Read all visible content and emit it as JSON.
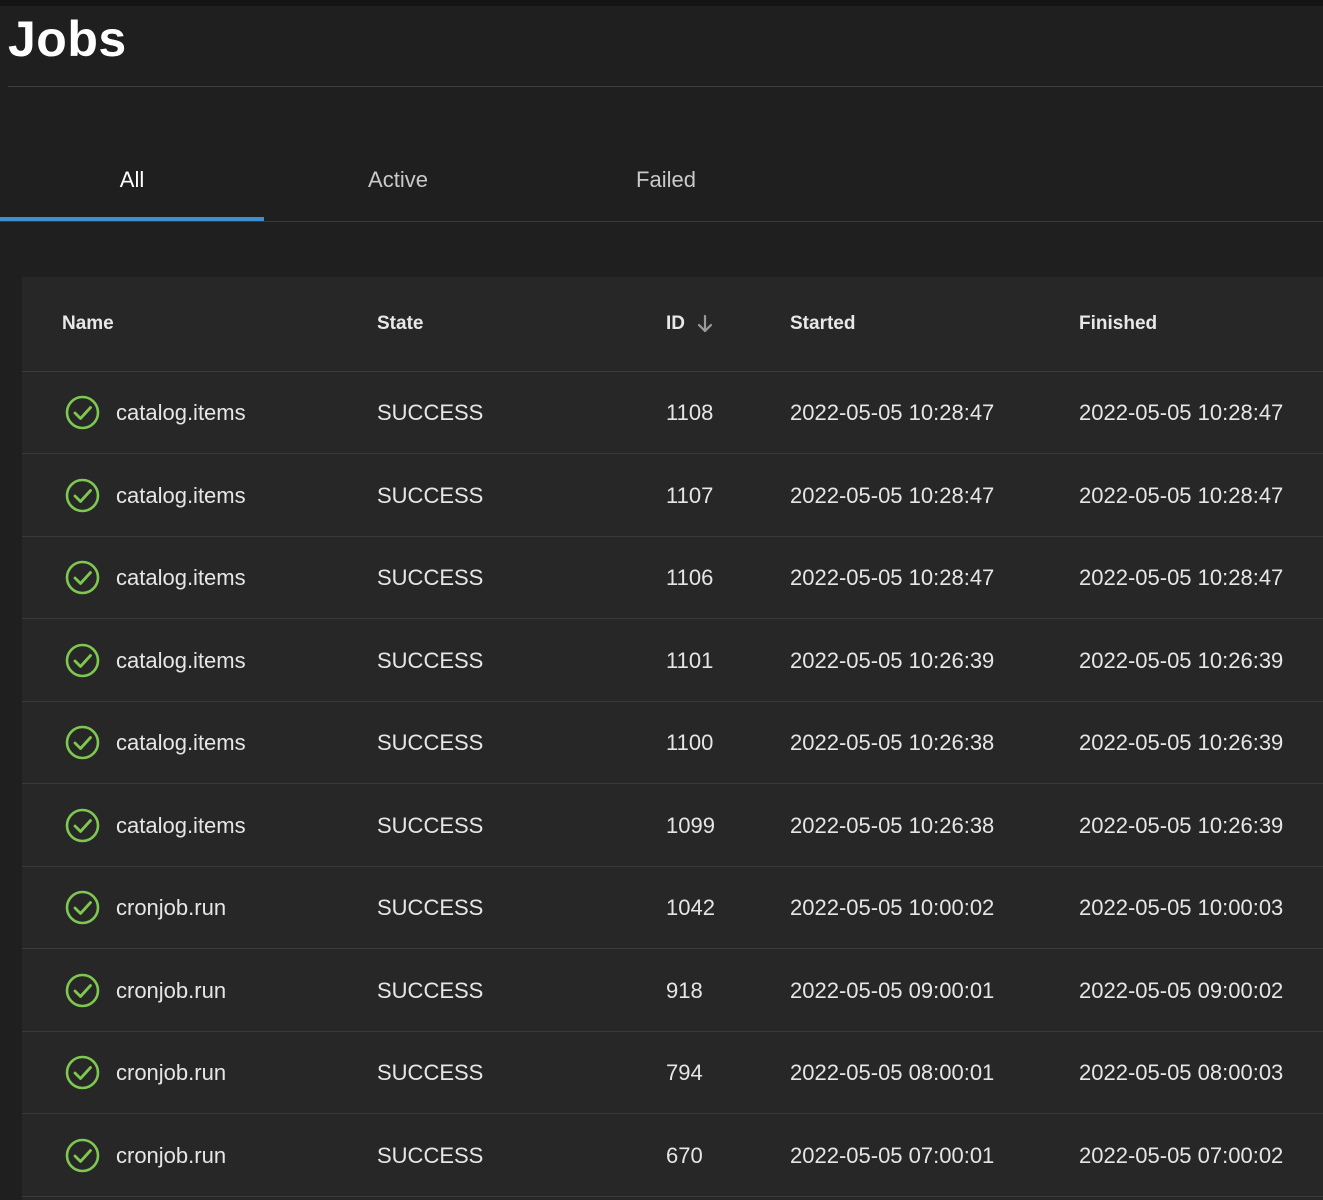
{
  "page": {
    "title": "Jobs"
  },
  "tabs": [
    {
      "label": "All",
      "active": true
    },
    {
      "label": "Active",
      "active": false
    },
    {
      "label": "Failed",
      "active": false
    }
  ],
  "table": {
    "columns": {
      "name": "Name",
      "state": "State",
      "id": "ID",
      "started": "Started",
      "finished": "Finished"
    },
    "sort": {
      "column": "ID",
      "direction": "descending"
    },
    "rows": [
      {
        "status_icon": "success-check-icon",
        "name": "catalog.items",
        "state": "SUCCESS",
        "id": "1108",
        "started": "2022-05-05 10:28:47",
        "finished": "2022-05-05 10:28:47"
      },
      {
        "status_icon": "success-check-icon",
        "name": "catalog.items",
        "state": "SUCCESS",
        "id": "1107",
        "started": "2022-05-05 10:28:47",
        "finished": "2022-05-05 10:28:47"
      },
      {
        "status_icon": "success-check-icon",
        "name": "catalog.items",
        "state": "SUCCESS",
        "id": "1106",
        "started": "2022-05-05 10:28:47",
        "finished": "2022-05-05 10:28:47"
      },
      {
        "status_icon": "success-check-icon",
        "name": "catalog.items",
        "state": "SUCCESS",
        "id": "1101",
        "started": "2022-05-05 10:26:39",
        "finished": "2022-05-05 10:26:39"
      },
      {
        "status_icon": "success-check-icon",
        "name": "catalog.items",
        "state": "SUCCESS",
        "id": "1100",
        "started": "2022-05-05 10:26:38",
        "finished": "2022-05-05 10:26:39"
      },
      {
        "status_icon": "success-check-icon",
        "name": "catalog.items",
        "state": "SUCCESS",
        "id": "1099",
        "started": "2022-05-05 10:26:38",
        "finished": "2022-05-05 10:26:39"
      },
      {
        "status_icon": "success-check-icon",
        "name": "cronjob.run",
        "state": "SUCCESS",
        "id": "1042",
        "started": "2022-05-05 10:00:02",
        "finished": "2022-05-05 10:00:03"
      },
      {
        "status_icon": "success-check-icon",
        "name": "cronjob.run",
        "state": "SUCCESS",
        "id": "918",
        "started": "2022-05-05 09:00:01",
        "finished": "2022-05-05 09:00:02"
      },
      {
        "status_icon": "success-check-icon",
        "name": "cronjob.run",
        "state": "SUCCESS",
        "id": "794",
        "started": "2022-05-05 08:00:01",
        "finished": "2022-05-05 08:00:03"
      },
      {
        "status_icon": "success-check-icon",
        "name": "cronjob.run",
        "state": "SUCCESS",
        "id": "670",
        "started": "2022-05-05 07:00:01",
        "finished": "2022-05-05 07:00:02"
      }
    ]
  },
  "colors": {
    "background": "#1f1f1f",
    "panel": "#272727",
    "accent": "#3d8fd1",
    "success": "#7ec850"
  }
}
